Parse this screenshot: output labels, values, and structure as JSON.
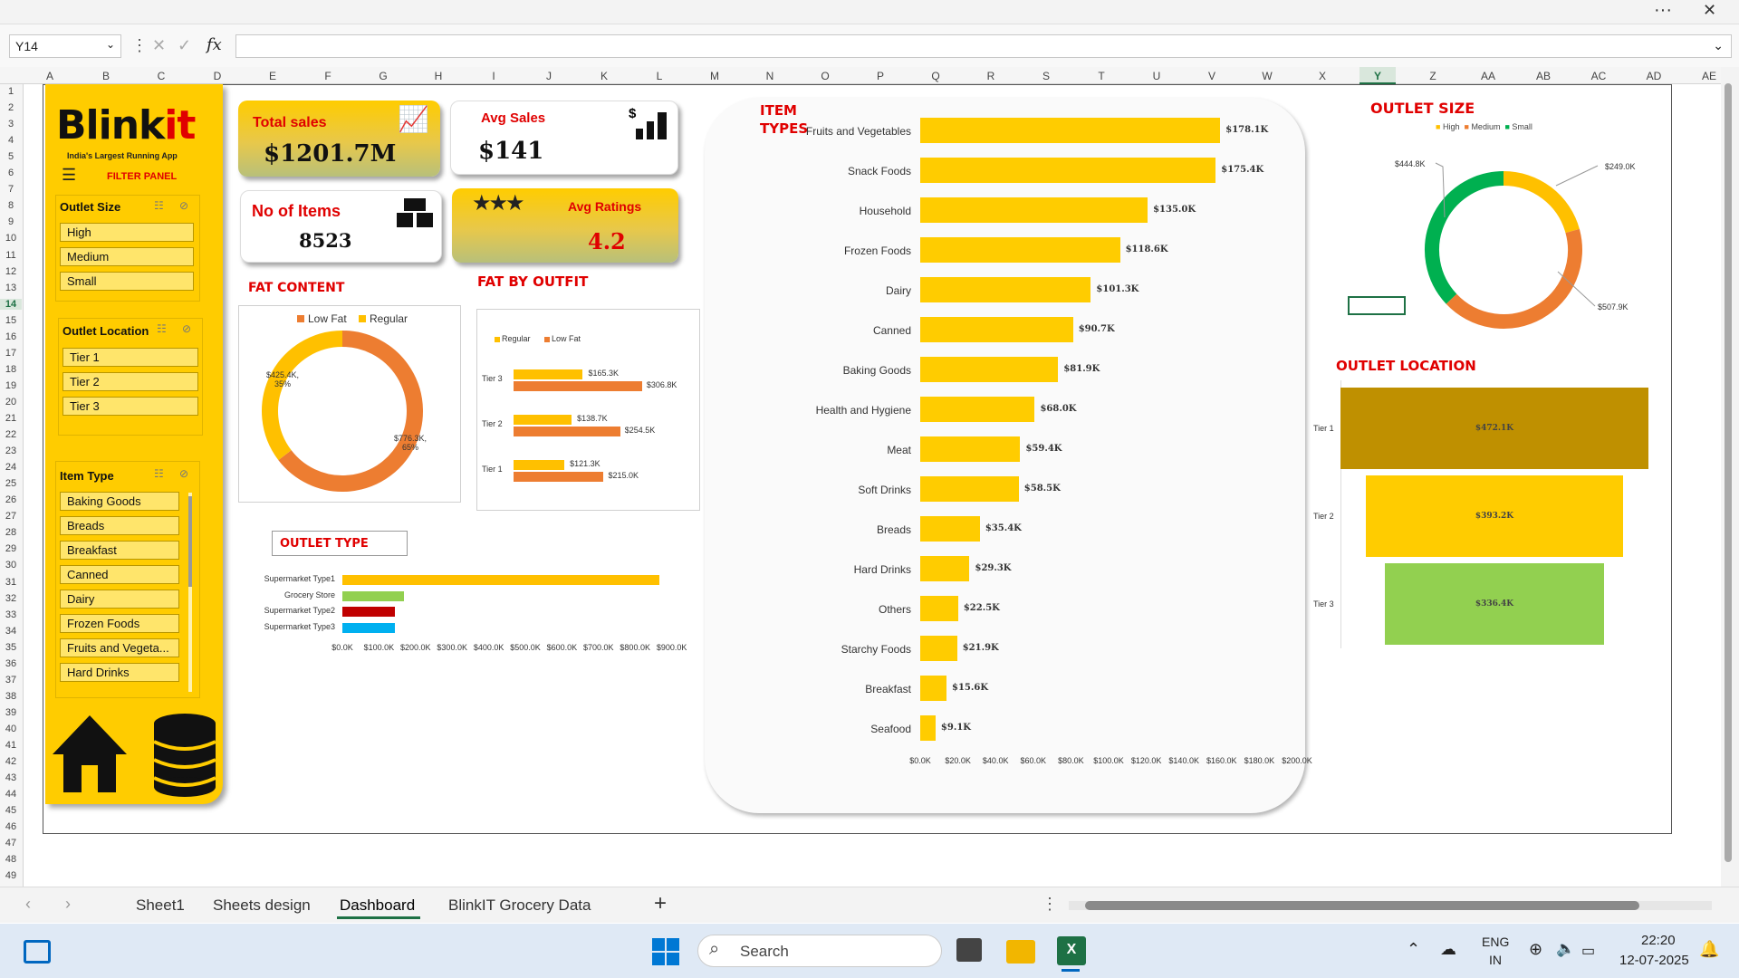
{
  "window": {
    "more_icon": "more-horizontal-icon",
    "close_icon": "close-icon"
  },
  "formula_bar": {
    "name_box": "Y14",
    "fx": "fx",
    "formula": ""
  },
  "columns": [
    "A",
    "B",
    "C",
    "D",
    "E",
    "F",
    "G",
    "H",
    "I",
    "J",
    "K",
    "L",
    "M",
    "N",
    "O",
    "P",
    "Q",
    "R",
    "S",
    "T",
    "U",
    "V",
    "W",
    "X",
    "Y",
    "Z",
    "AA",
    "AB",
    "AC",
    "AD",
    "AE"
  ],
  "rows": [
    "1",
    "2",
    "3",
    "4",
    "5",
    "6",
    "7",
    "8",
    "9",
    "10",
    "11",
    "12",
    "13",
    "14",
    "15",
    "16",
    "17",
    "18",
    "19",
    "20",
    "21",
    "22",
    "23",
    "24",
    "25",
    "26",
    "27",
    "28",
    "29",
    "30",
    "31",
    "32",
    "33",
    "34",
    "35",
    "36",
    "37",
    "38",
    "39",
    "40",
    "41",
    "42",
    "43",
    "44",
    "45",
    "46",
    "47",
    "48",
    "49"
  ],
  "sidebar": {
    "logo_black": "Blink",
    "logo_red": "it",
    "tagline": "India's Largest Running App",
    "filter_panel": "FILTER PANEL",
    "outlet_size": {
      "title": "Outlet Size",
      "items": [
        "High",
        "Medium",
        "Small"
      ]
    },
    "outlet_location": {
      "title": "Outlet Location",
      "items": [
        "Tier 1",
        "Tier 2",
        "Tier 3"
      ]
    },
    "item_type": {
      "title": "Item Type",
      "items": [
        "Baking Goods",
        "Breads",
        "Breakfast",
        "Canned",
        "Dairy",
        "Frozen Foods",
        "Fruits and Vegeta...",
        "Hard Drinks"
      ]
    }
  },
  "kpis": {
    "total_sales": {
      "label": "Total sales",
      "value": "$1201.7M"
    },
    "avg_sales": {
      "label": "Avg Sales",
      "value": "$141"
    },
    "no_items": {
      "label": "No of Items",
      "value": "8523"
    },
    "avg_ratings": {
      "label": "Avg Ratings",
      "value": "4.2"
    }
  },
  "sections": {
    "fat_content": "FAT CONTENT",
    "fat_by_outfit": "FAT BY OUTFIT",
    "outlet_type": "OUTLET TYPE",
    "item_types_1": "ITEM",
    "item_types_2": "TYPES",
    "outlet_size": "OUTLET SIZE",
    "outlet_location": "OUTLET LOCATION"
  },
  "colors": {
    "yellow": "#ffcc00",
    "orange": "#ed7d31",
    "red": "#e00000",
    "green": "#00b050",
    "lightgreen": "#92d050",
    "darkgold": "#bf9000",
    "crimson": "#c00000",
    "blue": "#00b0f0"
  },
  "chart_data": [
    {
      "type": "pie",
      "title": "FAT CONTENT",
      "labels": [
        "Low Fat",
        "Regular"
      ],
      "values": [
        776.3,
        425.4
      ],
      "value_labels": [
        "$776.3K, 65%",
        "$425.4K, 35%"
      ],
      "colors": [
        "#ed7d31",
        "#ffc000"
      ],
      "legend": "top"
    },
    {
      "type": "bar",
      "title": "FAT BY OUTFIT",
      "categories": [
        "Tier 3",
        "Tier 2",
        "Tier 1"
      ],
      "series": [
        {
          "name": "Regular",
          "values": [
            165.3,
            138.7,
            121.3
          ],
          "labels": [
            "$165.3K",
            "$138.7K",
            "$121.3K"
          ],
          "color": "#ffc000"
        },
        {
          "name": "Low Fat",
          "values": [
            306.8,
            254.5,
            215.0
          ],
          "labels": [
            "$306.8K",
            "$254.5K",
            "$215.0K"
          ],
          "color": "#ed7d31"
        }
      ],
      "legend": "top"
    },
    {
      "type": "bar",
      "title": "OUTLET TYPE",
      "categories": [
        "Supermarket Type1",
        "Grocery Store",
        "Supermarket Type2",
        "Supermarket Type3"
      ],
      "values": [
        787.5,
        151.9,
        131.5,
        130.7
      ],
      "colors": [
        "#ffc000",
        "#92d050",
        "#c00000",
        "#00b0f0"
      ],
      "xticks": [
        "$0.0K",
        "$100.0K",
        "$200.0K",
        "$300.0K",
        "$400.0K",
        "$500.0K",
        "$600.0K",
        "$700.0K",
        "$800.0K",
        "$900.0K"
      ],
      "xlim": [
        0,
        900
      ]
    },
    {
      "type": "bar",
      "title": "ITEM TYPES",
      "categories": [
        "Fruits and Vegetables",
        "Snack Foods",
        "Household",
        "Frozen Foods",
        "Dairy",
        "Canned",
        "Baking Goods",
        "Health and Hygiene",
        "Meat",
        "Soft Drinks",
        "Breads",
        "Hard Drinks",
        "Others",
        "Starchy Foods",
        "Breakfast",
        "Seafood"
      ],
      "values": [
        178.1,
        175.4,
        135.0,
        118.6,
        101.3,
        90.7,
        81.9,
        68.0,
        59.4,
        58.5,
        35.4,
        29.3,
        22.5,
        21.9,
        15.6,
        9.1
      ],
      "labels": [
        "$178.1K",
        "$175.4K",
        "$135.0K",
        "$118.6K",
        "$101.3K",
        "$90.7K",
        "$81.9K",
        "$68.0K",
        "$59.4K",
        "$58.5K",
        "$35.4K",
        "$29.3K",
        "$22.5K",
        "$21.9K",
        "$15.6K",
        "$9.1K"
      ],
      "xticks": [
        "$0.0K",
        "$20.0K",
        "$40.0K",
        "$60.0K",
        "$80.0K",
        "$100.0K",
        "$120.0K",
        "$140.0K",
        "$160.0K",
        "$180.0K",
        "$200.0K"
      ],
      "xlim": [
        0,
        200
      ],
      "color": "#ffcc00"
    },
    {
      "type": "pie",
      "title": "OUTLET SIZE",
      "labels": [
        "High",
        "Medium",
        "Small"
      ],
      "values": [
        249.0,
        507.9,
        444.8
      ],
      "value_labels": [
        "$249.0K",
        "$507.9K",
        "$444.8K"
      ],
      "colors": [
        "#ffc000",
        "#ed7d31",
        "#00b050"
      ],
      "legend": "top"
    },
    {
      "type": "bar",
      "title": "OUTLET LOCATION",
      "categories": [
        "Tier 1",
        "Tier 2",
        "Tier 3"
      ],
      "values": [
        472.1,
        393.2,
        336.4
      ],
      "labels": [
        "$472.1K",
        "$393.2K",
        "$336.4K"
      ],
      "colors": [
        "#bf9000",
        "#ffcc00",
        "#92d050"
      ]
    }
  ],
  "sheet_tabs": [
    "Sheet1",
    "Sheets design",
    "Dashboard",
    "BlinkIT Grocery Data"
  ],
  "active_tab": "Dashboard",
  "taskbar": {
    "search": "Search",
    "lang1": "ENG",
    "lang2": "IN",
    "time": "22:20",
    "date": "12-07-2025"
  }
}
